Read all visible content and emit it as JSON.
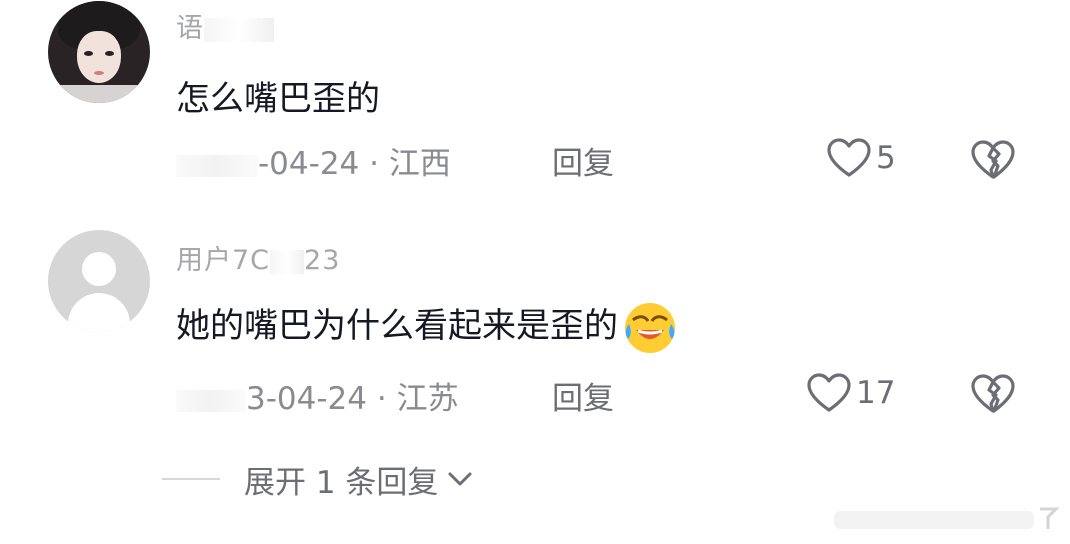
{
  "comments": [
    {
      "username_visible": "语",
      "text": "怎么嘴巴歪的",
      "date": "-04-24",
      "location": "江西",
      "reply_label": "回复",
      "likes": "5"
    },
    {
      "username_visible": "用户7C",
      "username_tail": "23",
      "text": "她的嘴巴为什么看起来是歪的",
      "emoji": "laughing-crying-emoji",
      "date": "3-04-24",
      "location": "江苏",
      "reply_label": "回复",
      "likes": "17"
    }
  ],
  "separator": "·",
  "expand_label": "展开 1 条回复",
  "colors": {
    "text_primary": "#161823",
    "text_secondary": "#8a8b91",
    "icon_gray": "#6d6e75"
  }
}
